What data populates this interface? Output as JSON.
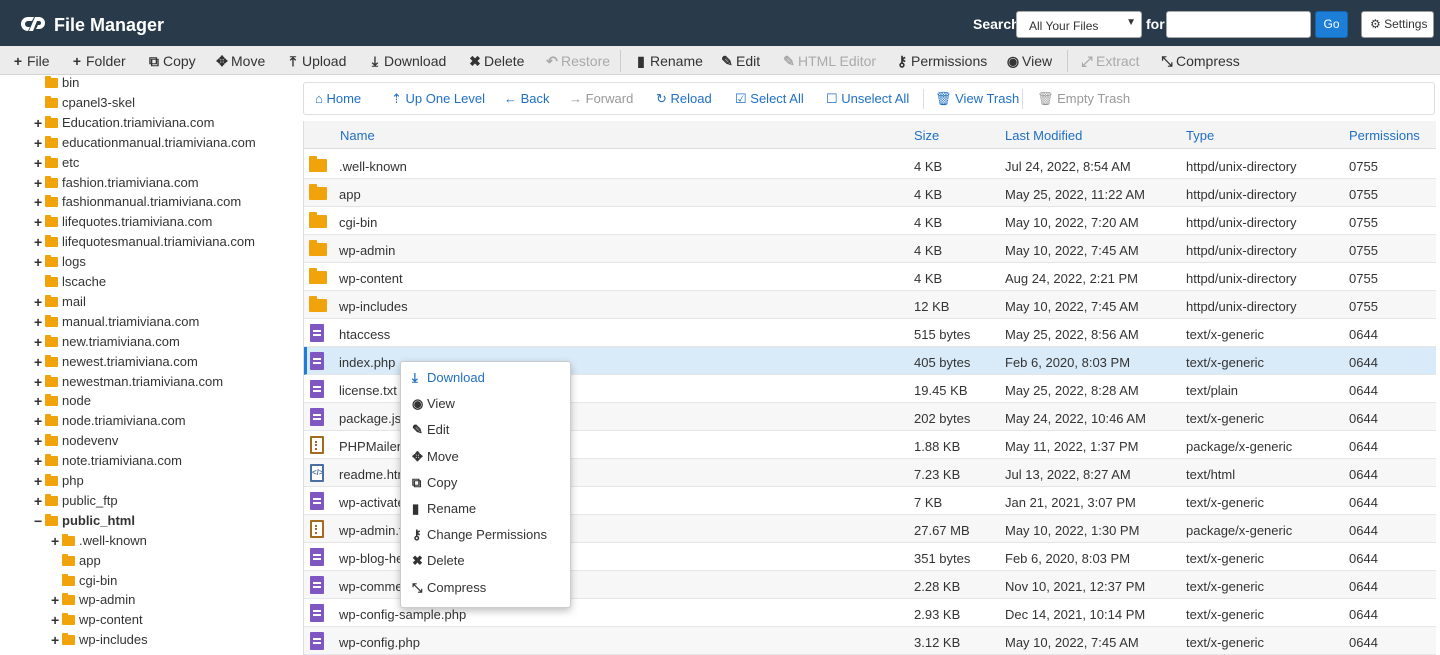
{
  "header": {
    "app_title": "File Manager",
    "search_label": "Search",
    "search_scope": "All Your Files",
    "for_label": "for",
    "search_value": "",
    "go_label": "Go",
    "settings_label": "Settings"
  },
  "toolbar": [
    {
      "label": "File",
      "icon": "plus-icon",
      "glyph": "+",
      "disabled": false
    },
    {
      "label": "Folder",
      "icon": "plus-icon",
      "glyph": "+",
      "disabled": false
    },
    {
      "label": "Copy",
      "icon": "copy-icon",
      "glyph": "⧉",
      "disabled": false
    },
    {
      "label": "Move",
      "icon": "move-icon",
      "glyph": "✥",
      "disabled": false
    },
    {
      "label": "Upload",
      "icon": "upload-icon",
      "glyph": "⤒",
      "disabled": false
    },
    {
      "label": "Download",
      "icon": "download-icon",
      "glyph": "⤓",
      "disabled": false
    },
    {
      "label": "Delete",
      "icon": "delete-icon",
      "glyph": "✖",
      "disabled": false
    },
    {
      "label": "Restore",
      "icon": "restore-icon",
      "glyph": "↶",
      "disabled": true
    },
    {
      "label": "Rename",
      "icon": "rename-icon",
      "glyph": "▮",
      "disabled": false
    },
    {
      "label": "Edit",
      "icon": "pencil-icon",
      "glyph": "✎",
      "disabled": false
    },
    {
      "label": "HTML Editor",
      "icon": "html-editor-icon",
      "glyph": "✎",
      "disabled": true
    },
    {
      "label": "Permissions",
      "icon": "key-icon",
      "glyph": "⚷",
      "disabled": false
    },
    {
      "label": "View",
      "icon": "eye-icon",
      "glyph": "◉",
      "disabled": false
    },
    {
      "label": "Extract",
      "icon": "extract-icon",
      "glyph": "⤢",
      "disabled": true
    },
    {
      "label": "Compress",
      "icon": "compress-icon",
      "glyph": "⤡",
      "disabled": false
    }
  ],
  "tree": [
    {
      "label": "bin",
      "toggle": ""
    },
    {
      "label": "cpanel3-skel",
      "toggle": ""
    },
    {
      "label": "Education.triamiviana.com",
      "toggle": "+"
    },
    {
      "label": "educationmanual.triamiviana.com",
      "toggle": "+"
    },
    {
      "label": "etc",
      "toggle": "+"
    },
    {
      "label": "fashion.triamiviana.com",
      "toggle": "+"
    },
    {
      "label": "fashionmanual.triamiviana.com",
      "toggle": "+"
    },
    {
      "label": "lifequotes.triamiviana.com",
      "toggle": "+"
    },
    {
      "label": "lifequotesmanual.triamiviana.com",
      "toggle": "+"
    },
    {
      "label": "logs",
      "toggle": "+"
    },
    {
      "label": "lscache",
      "toggle": ""
    },
    {
      "label": "mail",
      "toggle": "+"
    },
    {
      "label": "manual.triamiviana.com",
      "toggle": "+"
    },
    {
      "label": "new.triamiviana.com",
      "toggle": "+"
    },
    {
      "label": "newest.triamiviana.com",
      "toggle": "+"
    },
    {
      "label": "newestman.triamiviana.com",
      "toggle": "+"
    },
    {
      "label": "node",
      "toggle": "+"
    },
    {
      "label": "node.triamiviana.com",
      "toggle": "+"
    },
    {
      "label": "nodevenv",
      "toggle": "+"
    },
    {
      "label": "note.triamiviana.com",
      "toggle": "+"
    },
    {
      "label": "php",
      "toggle": "+"
    },
    {
      "label": "public_ftp",
      "toggle": "+"
    },
    {
      "label": "public_html",
      "toggle": "−"
    },
    {
      "label": ".well-known",
      "toggle": "+"
    },
    {
      "label": "app",
      "toggle": ""
    },
    {
      "label": "cgi-bin",
      "toggle": ""
    },
    {
      "label": "wp-admin",
      "toggle": "+"
    },
    {
      "label": "wp-content",
      "toggle": "+"
    },
    {
      "label": "wp-includes",
      "toggle": "+"
    }
  ],
  "nav": [
    {
      "label": "Home",
      "icon": "home-icon",
      "glyph": "⌂",
      "disabled": false
    },
    {
      "label": "Up One Level",
      "icon": "level-up-icon",
      "glyph": "⇡",
      "disabled": false
    },
    {
      "label": "Back",
      "icon": "back-arrow-icon",
      "glyph": "←",
      "disabled": false
    },
    {
      "label": "Forward",
      "icon": "forward-arrow-icon",
      "glyph": "→",
      "disabled": true
    },
    {
      "label": "Reload",
      "icon": "reload-icon",
      "glyph": "↻",
      "disabled": false
    },
    {
      "label": "Select All",
      "icon": "checkbox-checked-icon",
      "glyph": "☑",
      "disabled": false
    },
    {
      "label": "Unselect All",
      "icon": "checkbox-empty-icon",
      "glyph": "☐",
      "disabled": false
    },
    {
      "label": "View Trash",
      "icon": "trash-icon",
      "glyph": "🗑",
      "disabled": false
    },
    {
      "label": "Empty Trash",
      "icon": "trash-icon",
      "glyph": "🗑",
      "disabled": true
    }
  ],
  "table": {
    "headers": {
      "name": "Name",
      "size": "Size",
      "modified": "Last Modified",
      "type": "Type",
      "perms": "Permissions"
    },
    "rows": [
      {
        "name": ".well-known",
        "size": "4 KB",
        "modified": "Jul 24, 2022, 8:54 AM",
        "type": "httpd/unix-directory",
        "perms": "0755",
        "kind": "folder"
      },
      {
        "name": "app",
        "size": "4 KB",
        "modified": "May 25, 2022, 11:22 AM",
        "type": "httpd/unix-directory",
        "perms": "0755",
        "kind": "folder"
      },
      {
        "name": "cgi-bin",
        "size": "4 KB",
        "modified": "May 10, 2022, 7:20 AM",
        "type": "httpd/unix-directory",
        "perms": "0755",
        "kind": "folder"
      },
      {
        "name": "wp-admin",
        "size": "4 KB",
        "modified": "May 10, 2022, 7:45 AM",
        "type": "httpd/unix-directory",
        "perms": "0755",
        "kind": "folder"
      },
      {
        "name": "wp-content",
        "size": "4 KB",
        "modified": "Aug 24, 2022, 2:21 PM",
        "type": "httpd/unix-directory",
        "perms": "0755",
        "kind": "folder"
      },
      {
        "name": "wp-includes",
        "size": "12 KB",
        "modified": "May 10, 2022, 7:45 AM",
        "type": "httpd/unix-directory",
        "perms": "0755",
        "kind": "folder"
      },
      {
        "name": "htaccess",
        "size": "515 bytes",
        "modified": "May 25, 2022, 8:56 AM",
        "type": "text/x-generic",
        "perms": "0644",
        "kind": "file"
      },
      {
        "name": "index.php",
        "size": "405 bytes",
        "modified": "Feb 6, 2020, 8:03 PM",
        "type": "text/x-generic",
        "perms": "0644",
        "kind": "file"
      },
      {
        "name": "license.txt",
        "size": "19.45 KB",
        "modified": "May 25, 2022, 8:28 AM",
        "type": "text/plain",
        "perms": "0644",
        "kind": "file"
      },
      {
        "name": "package.js",
        "size": "202 bytes",
        "modified": "May 24, 2022, 10:46 AM",
        "type": "text/x-generic",
        "perms": "0644",
        "kind": "file"
      },
      {
        "name": "PHPMailer-",
        "size": "1.88 KB",
        "modified": "May 11, 2022, 1:37 PM",
        "type": "package/x-generic",
        "perms": "0644",
        "kind": "pkg"
      },
      {
        "name": "readme.htm",
        "size": "7.23 KB",
        "modified": "Jul 13, 2022, 8:27 AM",
        "type": "text/html",
        "perms": "0644",
        "kind": "html"
      },
      {
        "name": "wp-activate",
        "size": "7 KB",
        "modified": "Jan 21, 2021, 3:07 PM",
        "type": "text/x-generic",
        "perms": "0644",
        "kind": "file"
      },
      {
        "name": "wp-admin.t",
        "size": "27.67 MB",
        "modified": "May 10, 2022, 1:30 PM",
        "type": "package/x-generic",
        "perms": "0644",
        "kind": "pkg"
      },
      {
        "name": "wp-blog-he",
        "size": "351 bytes",
        "modified": "Feb 6, 2020, 8:03 PM",
        "type": "text/x-generic",
        "perms": "0644",
        "kind": "file"
      },
      {
        "name": "wp-comme",
        "size": "2.28 KB",
        "modified": "Nov 10, 2021, 12:37 PM",
        "type": "text/x-generic",
        "perms": "0644",
        "kind": "file"
      },
      {
        "name": "wp-config-sample.php",
        "size": "2.93 KB",
        "modified": "Dec 14, 2021, 10:14 PM",
        "type": "text/x-generic",
        "perms": "0644",
        "kind": "file"
      },
      {
        "name": "wp-config.php",
        "size": "3.12 KB",
        "modified": "May 10, 2022, 7:45 AM",
        "type": "text/x-generic",
        "perms": "0644",
        "kind": "file"
      }
    ],
    "selected_row": 7
  },
  "context_menu": [
    {
      "label": "Download",
      "icon": "download-icon",
      "glyph": "⤓"
    },
    {
      "label": "View",
      "icon": "eye-icon",
      "glyph": "◉"
    },
    {
      "label": "Edit",
      "icon": "pencil-icon",
      "glyph": "✎"
    },
    {
      "label": "Move",
      "icon": "move-icon",
      "glyph": "✥"
    },
    {
      "label": "Copy",
      "icon": "copy-icon",
      "glyph": "⧉"
    },
    {
      "label": "Rename",
      "icon": "rename-icon",
      "glyph": "▮"
    },
    {
      "label": "Change Permissions",
      "icon": "key-icon",
      "glyph": "⚷"
    },
    {
      "label": "Delete",
      "icon": "delete-icon",
      "glyph": "✖"
    },
    {
      "label": "Compress",
      "icon": "compress-icon",
      "glyph": "⤡"
    }
  ],
  "colors": {
    "header_bg": "#293a4a",
    "accent": "#1c7ed6",
    "link": "#1f6fc5",
    "folder": "#f0a30a",
    "file": "#7e57c2"
  }
}
